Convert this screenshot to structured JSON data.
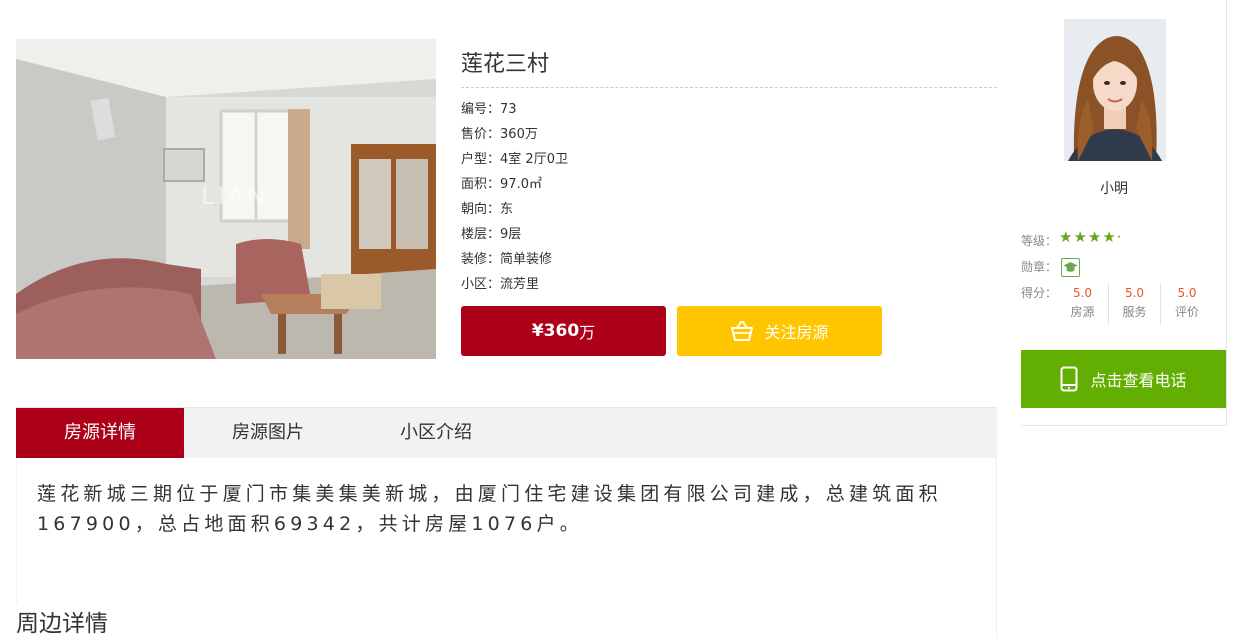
{
  "listing": {
    "title": "莲花三村",
    "fields": [
      {
        "label": "编号",
        "value": "73"
      },
      {
        "label": "售价",
        "value": "360万"
      },
      {
        "label": "户型",
        "value": "4室 2厅0卫"
      },
      {
        "label": "面积",
        "value": "97.0㎡"
      },
      {
        "label": "朝向",
        "value": "东"
      },
      {
        "label": "楼层",
        "value": "9层"
      },
      {
        "label": "装修",
        "value": "简单装修"
      },
      {
        "label": "小区",
        "value": "流芳里"
      }
    ],
    "separator": "：",
    "price_amount": "¥360",
    "price_unit": "万",
    "follow_label": "关注房源",
    "photo_watermark": "LIAN"
  },
  "tabs": [
    {
      "label": "房源详情",
      "active": true
    },
    {
      "label": "房源图片",
      "active": false
    },
    {
      "label": "小区介绍",
      "active": false
    }
  ],
  "description": "莲花新城三期位于厦门市集美集美新城，由厦门住宅建设集团有限公司建成，总建筑面积167900，总占地面积69342，共计房屋1076户。",
  "surroundings_heading": "周边详情",
  "agent": {
    "name": "小明",
    "level_label": "等级：",
    "level_stars": "★★★★·",
    "medal_label": "勋章：",
    "score_label": "得分：",
    "scores": [
      {
        "value": "5.0",
        "label": "房源"
      },
      {
        "value": "5.0",
        "label": "服务"
      },
      {
        "value": "5.0",
        "label": "评价"
      }
    ],
    "phone_label": "点击查看电话"
  },
  "colors": {
    "brand_red": "#ad0019",
    "follow_yellow": "#ffc600",
    "phone_green": "#63ae02",
    "star_green": "#66a61e",
    "score_orange": "#e0582b"
  },
  "icons": {
    "follow": "basket-icon",
    "phone": "mobile-phone-icon",
    "medal": "graduation-cap-icon"
  }
}
